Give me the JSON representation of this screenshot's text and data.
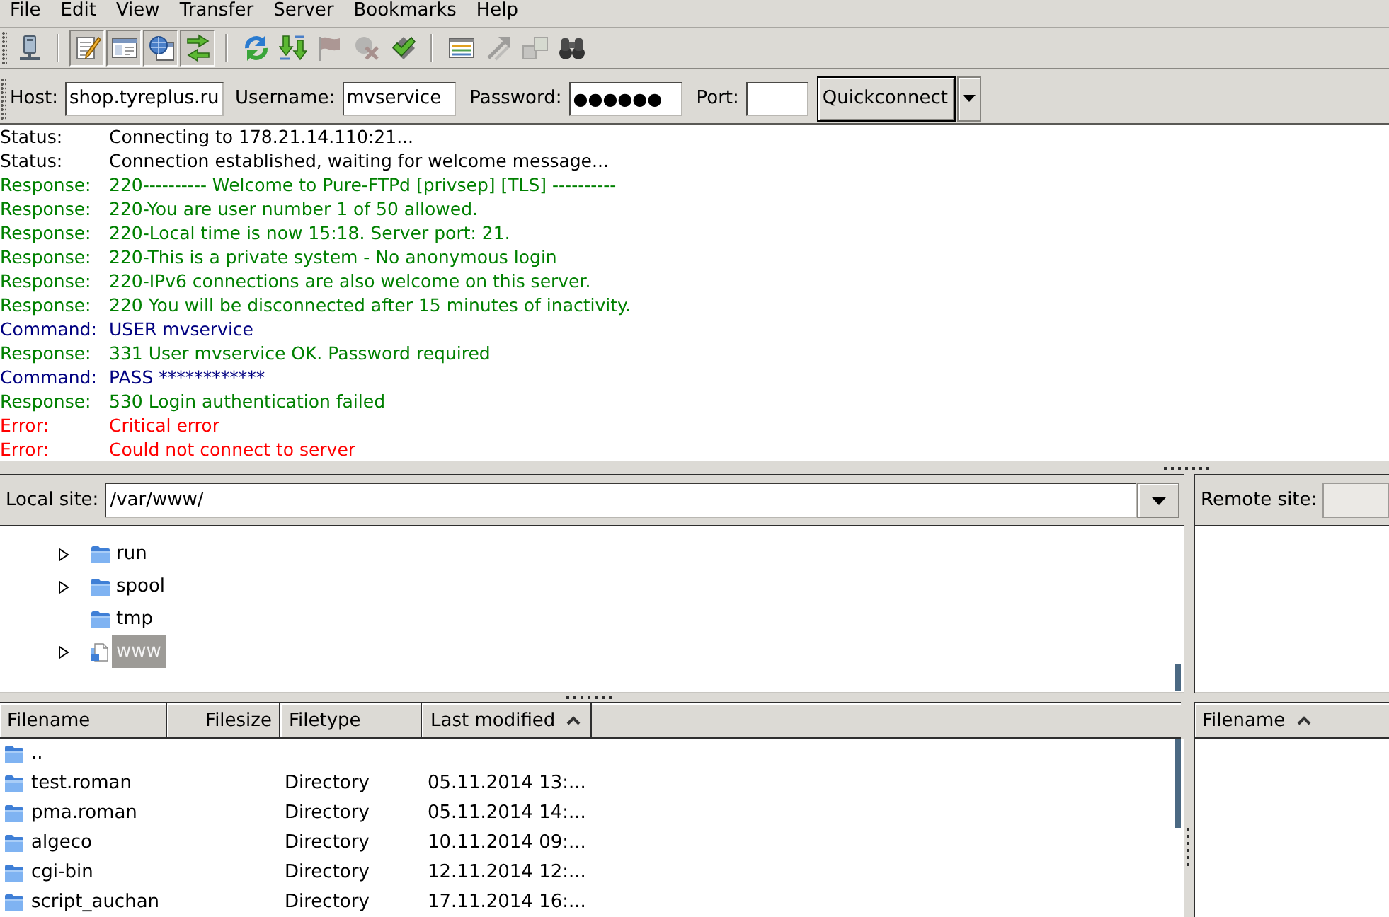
{
  "menu_bar": [
    "File",
    "Edit",
    "View",
    "Transfer",
    "Server",
    "Bookmarks",
    "Help"
  ],
  "toolbar": {
    "groups": [
      [
        {
          "on": false,
          "disabled": false
        }
      ],
      [
        {
          "on": true,
          "disabled": false
        },
        {
          "on": true,
          "disabled": false
        },
        {
          "on": true,
          "disabled": false
        },
        {
          "on": true,
          "disabled": false
        }
      ],
      [
        {
          "on": false,
          "disabled": false
        },
        {
          "on": false,
          "disabled": false
        },
        {
          "on": false,
          "disabled": true
        },
        {
          "on": false,
          "disabled": true
        },
        {
          "on": false,
          "disabled": false
        }
      ],
      [
        {
          "on": false,
          "disabled": false
        },
        {
          "on": false,
          "disabled": true
        },
        {
          "on": false,
          "disabled": true
        },
        {
          "on": false,
          "disabled": false
        }
      ]
    ]
  },
  "quickconnect": {
    "fields": [
      {
        "kind": "host",
        "label": "Host:",
        "value": "shop.tyreplus.ru"
      },
      {
        "kind": "username",
        "label": "Username:",
        "value": "mvservice"
      },
      {
        "kind": "password",
        "label": "Password:",
        "value": "●●●●●●"
      },
      {
        "kind": "port",
        "label": "Port:"
      }
    ],
    "button": "Quickconnect"
  },
  "message_log": [
    {
      "kind": "status",
      "label": "Status:",
      "text": "Connecting to 178.21.14.110:21..."
    },
    {
      "kind": "status",
      "label": "Status:",
      "text": "Connection established, waiting for welcome message..."
    },
    {
      "kind": "response",
      "label": "Response:",
      "text": "220---------- Welcome to Pure-FTPd [privsep] [TLS] ----------"
    },
    {
      "kind": "response",
      "label": "Response:",
      "text": "220-You are user number 1 of 50 allowed."
    },
    {
      "kind": "response",
      "label": "Response:",
      "text": "220-Local time is now 15:18. Server port: 21."
    },
    {
      "kind": "response",
      "label": "Response:",
      "text": "220-This is a private system - No anonymous login"
    },
    {
      "kind": "response",
      "label": "Response:",
      "text": "220-IPv6 connections are also welcome on this server."
    },
    {
      "kind": "response",
      "label": "Response:",
      "text": "220 You will be disconnected after 15 minutes of inactivity."
    },
    {
      "kind": "command",
      "label": "Command:",
      "text": "USER mvservice"
    },
    {
      "kind": "response",
      "label": "Response:",
      "text": "331 User mvservice OK. Password required"
    },
    {
      "kind": "command",
      "label": "Command:",
      "text": "PASS ************"
    },
    {
      "kind": "response",
      "label": "Response:",
      "text": "530 Login authentication failed"
    },
    {
      "kind": "error",
      "label": "Error:",
      "text": "Critical error"
    },
    {
      "kind": "error",
      "label": "Error:",
      "text": "Could not connect to server"
    }
  ],
  "local_site": {
    "label": "Local site:",
    "path": "/var/www/",
    "tree": [
      {
        "name": "run",
        "expandable": true,
        "expanded": false,
        "selected": false
      },
      {
        "name": "spool",
        "expandable": true,
        "expanded": false,
        "selected": false
      },
      {
        "name": "tmp",
        "expandable": false,
        "selected": false
      },
      {
        "name": "www",
        "expandable": true,
        "expanded": false,
        "selected": true
      }
    ]
  },
  "remote_site": {
    "label": "Remote site:",
    "disabled": true
  },
  "local_files": {
    "columns": [
      {
        "label": "Filename",
        "sorted": false
      },
      {
        "label": "Filesize",
        "sorted": false
      },
      {
        "label": "Filetype",
        "sorted": false
      },
      {
        "label": "Last modified",
        "sorted": true
      }
    ],
    "rows": [
      {
        "name": ".."
      },
      {
        "name": "test.roman",
        "type": "Directory",
        "modified": "05.11.2014 13:..."
      },
      {
        "name": "pma.roman",
        "type": "Directory",
        "modified": "05.11.2014 14:..."
      },
      {
        "name": "algeco",
        "type": "Directory",
        "modified": "10.11.2014 09:..."
      },
      {
        "name": "cgi-bin",
        "type": "Directory",
        "modified": "12.11.2014 12:..."
      },
      {
        "name": "script_auchan",
        "type": "Directory",
        "modified": "17.11.2014 16:..."
      }
    ]
  },
  "remote_files": {
    "columns": [
      {
        "label": "Filename",
        "sorted": true
      }
    ]
  }
}
